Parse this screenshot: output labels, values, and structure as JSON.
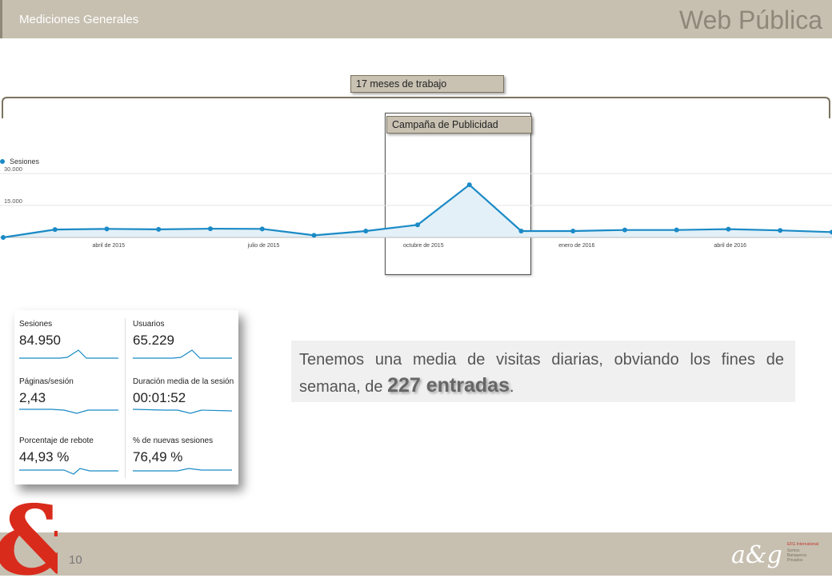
{
  "header": {
    "section": "Mediciones Generales",
    "title": "Web Pública"
  },
  "callouts": {
    "months": "17 meses de trabajo",
    "campaign": "Campaña de Publicidad"
  },
  "chart_data": {
    "type": "line",
    "legend": "Sesiones",
    "legend_position": "top-left",
    "y_ticks": [
      "30.000",
      "15.000"
    ],
    "ylim": [
      0,
      30000
    ],
    "x_ticks": [
      {
        "label": "abril de 2015",
        "pos": 2.0
      },
      {
        "label": "julio de 2015",
        "pos": 5.0
      },
      {
        "label": "octubre de 2015",
        "pos": 8.0
      },
      {
        "label": "enero de 2016",
        "pos": 11.0
      },
      {
        "label": "abril de 2016",
        "pos": 14.0
      }
    ],
    "x": [
      0,
      1,
      2,
      3,
      4,
      5,
      6,
      7,
      8,
      9,
      10,
      11,
      12,
      13,
      14,
      15,
      16
    ],
    "values": [
      0,
      3700,
      4000,
      3800,
      4100,
      4000,
      1000,
      3000,
      5900,
      24700,
      3000,
      3000,
      3500,
      3500,
      3900,
      3300,
      2500
    ],
    "grid": true,
    "color": "#1a8ac6"
  },
  "metrics": [
    {
      "label": "Sesiones",
      "value": "84.950"
    },
    {
      "label": "Usuarios",
      "value": "65.229"
    },
    {
      "label": "Páginas/sesión",
      "value": "2,43"
    },
    {
      "label": "Duración media de la sesión",
      "value": "00:01:52"
    },
    {
      "label": "Porcentaje de rebote",
      "value": "44,93 %"
    },
    {
      "label": "% de nuevas sesiones",
      "value": "76,49 %"
    }
  ],
  "info": {
    "text_before": "Tenemos una media de visitas diarias, obviando los fines de semana, de ",
    "highlight": "227 entradas",
    "text_after": "."
  },
  "footer": {
    "page_number": "10",
    "brand": "a&g",
    "brand_lines": [
      "EFG International",
      "Somos",
      "Banqueros",
      "Privados"
    ]
  },
  "colors": {
    "header": "#c7c0b1",
    "line": "#1a8ac6",
    "fill": "#e3f0f7",
    "logo_red": "#d92b1c"
  }
}
